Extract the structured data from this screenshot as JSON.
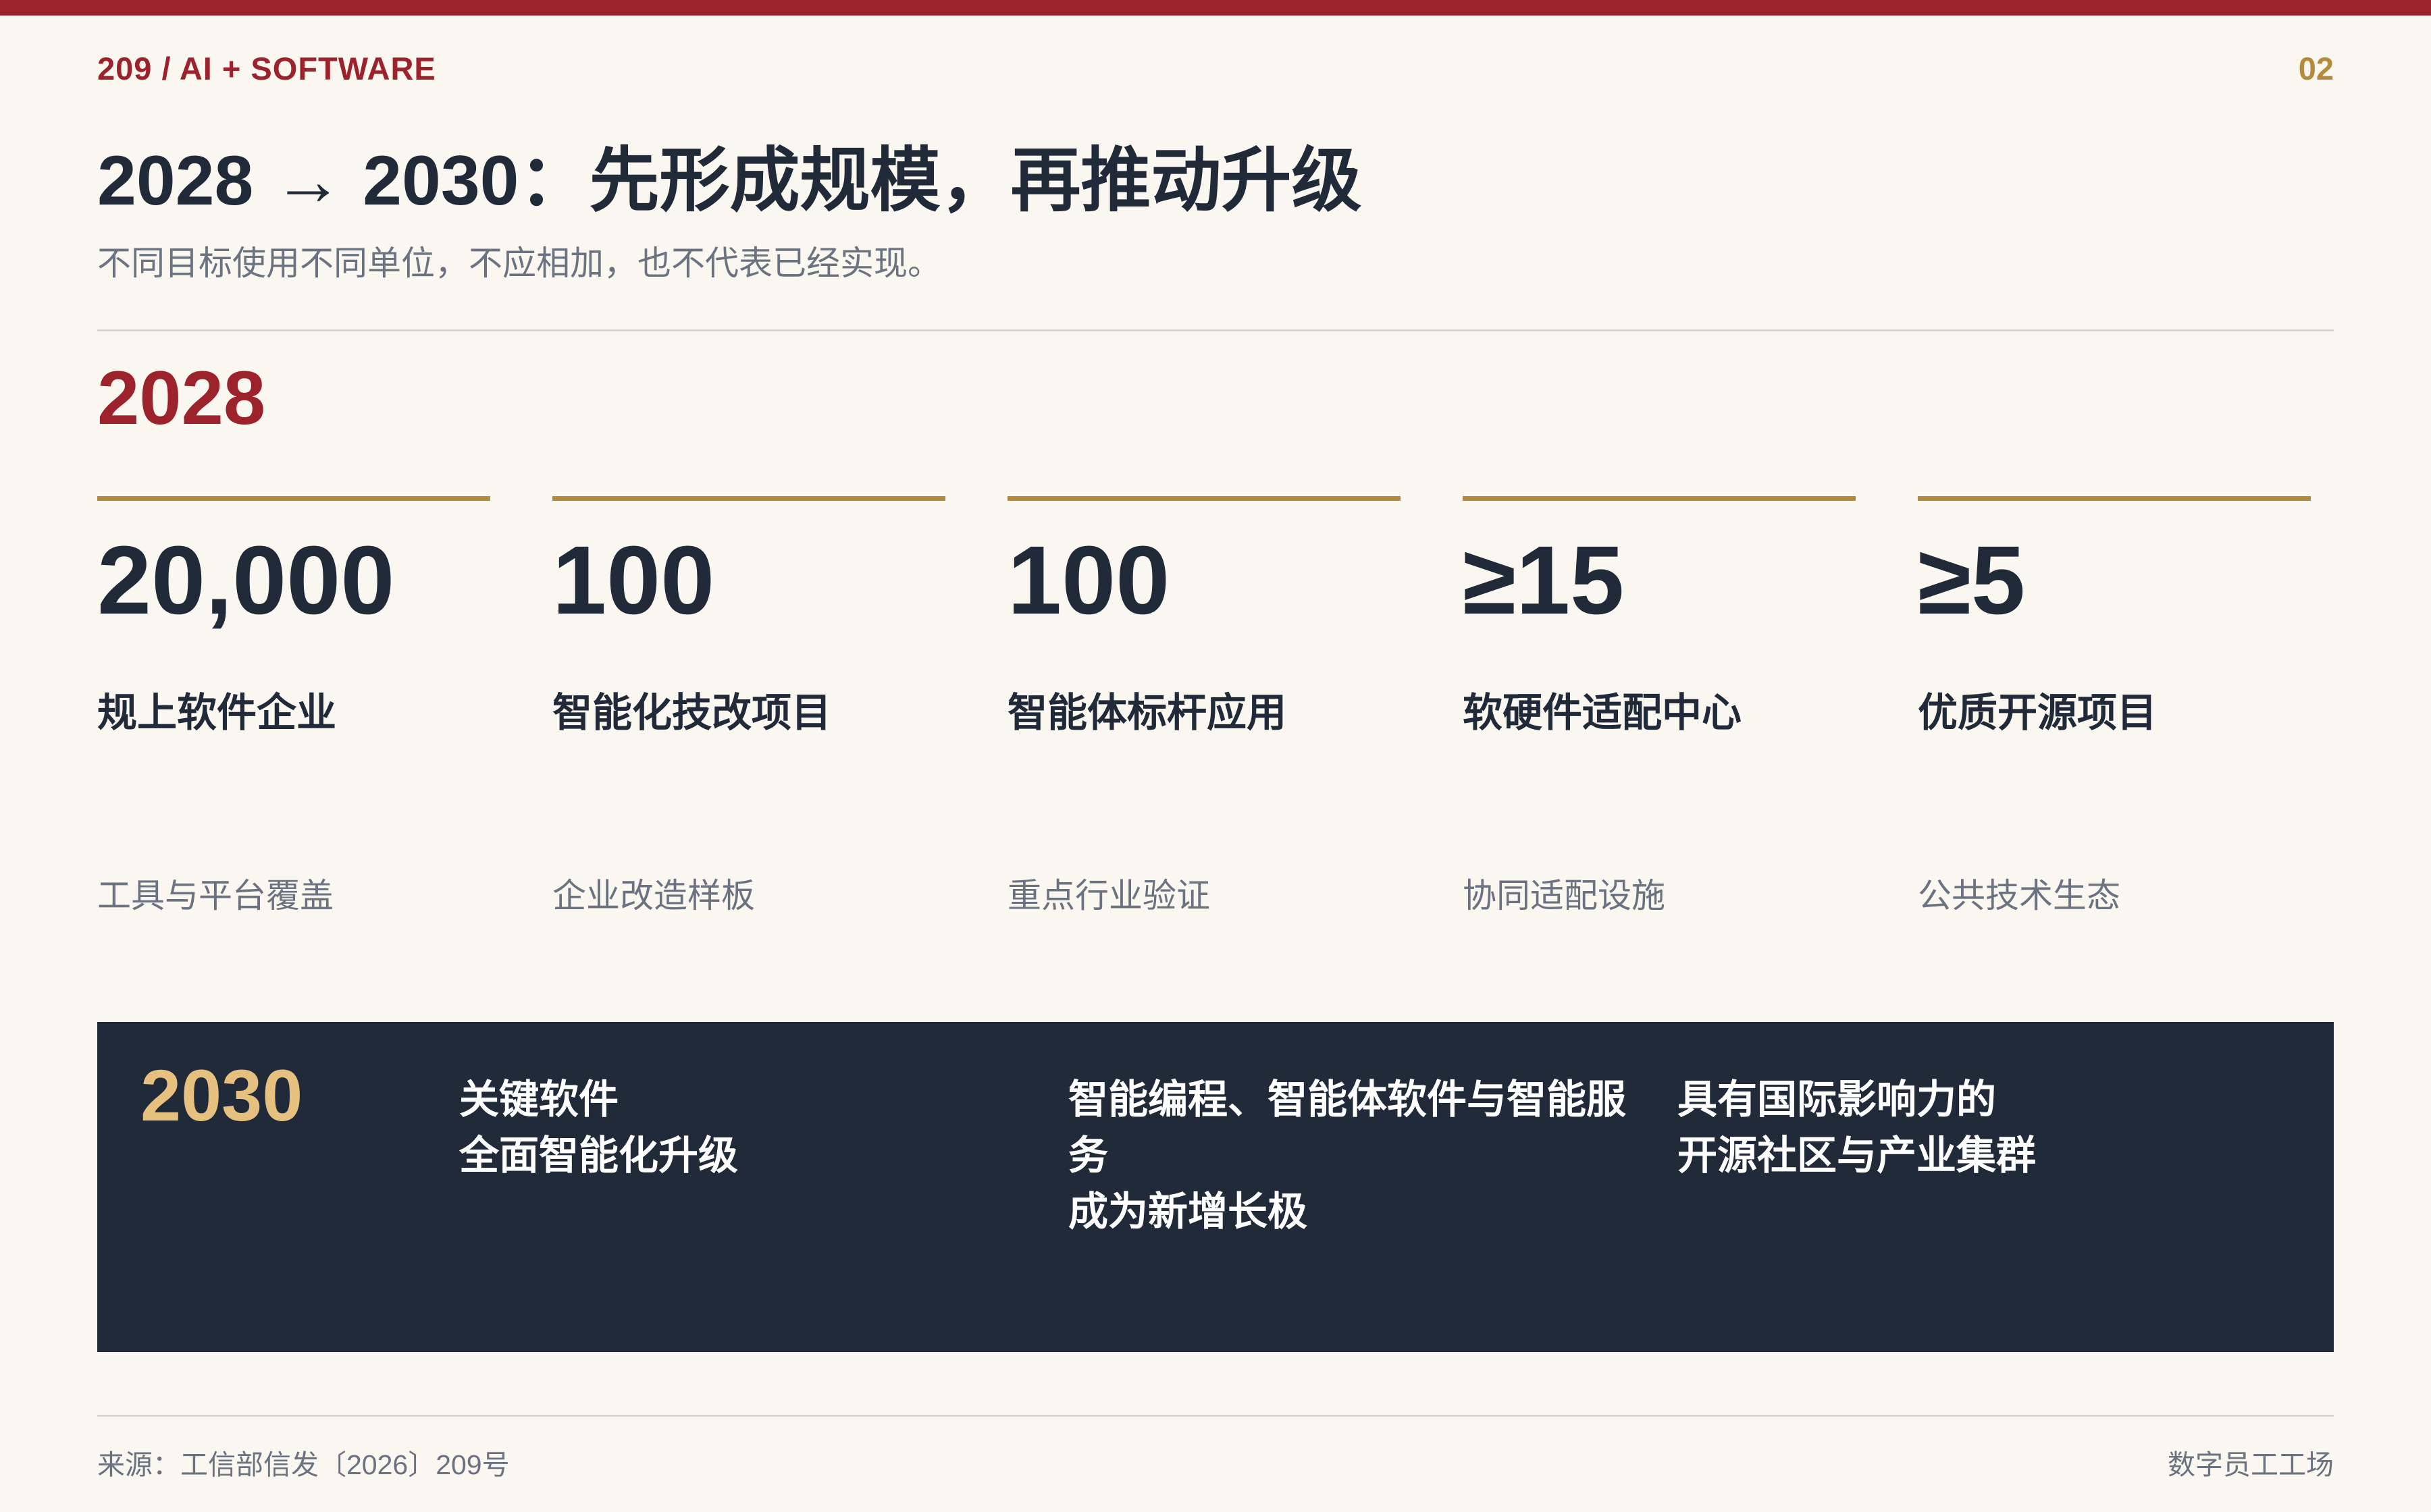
{
  "header": {
    "kicker": "209  /  AI + SOFTWARE",
    "page_number": "02",
    "title": "2028 → 2030：先形成规模，再推动升级",
    "subtitle": "不同目标使用不同单位，不应相加，也不代表已经实现。"
  },
  "section_2028": {
    "year": "2028",
    "metrics": [
      {
        "value": "20,000",
        "label": "规上软件企业",
        "note": "工具与平台覆盖"
      },
      {
        "value": "100",
        "label": "智能化技改项目",
        "note": "企业改造样板"
      },
      {
        "value": "100",
        "label": "智能体标杆应用",
        "note": "重点行业验证"
      },
      {
        "value": "≥15",
        "label": "软硬件适配中心",
        "note": "协同适配设施"
      },
      {
        "value": "≥5",
        "label": "优质开源项目",
        "note": "公共技术生态"
      }
    ]
  },
  "section_2030": {
    "year": "2030",
    "goals": [
      {
        "lines": [
          "关键软件",
          "全面智能化升级"
        ]
      },
      {
        "lines": [
          "智能编程、智能体软件与智能服",
          "务",
          "成为新增长极"
        ]
      },
      {
        "lines": [
          "具有国际影响力的",
          "开源社区与产业集群"
        ]
      }
    ]
  },
  "footer": {
    "source": "来源：工信部信发〔2026〕209号",
    "brand": "数字员工工场"
  },
  "colors": {
    "primary_red": "#9c222c",
    "gold": "#b68a3d",
    "navy": "#212a39",
    "light_gold": "#e5c07e",
    "background": "#faf7f1"
  }
}
